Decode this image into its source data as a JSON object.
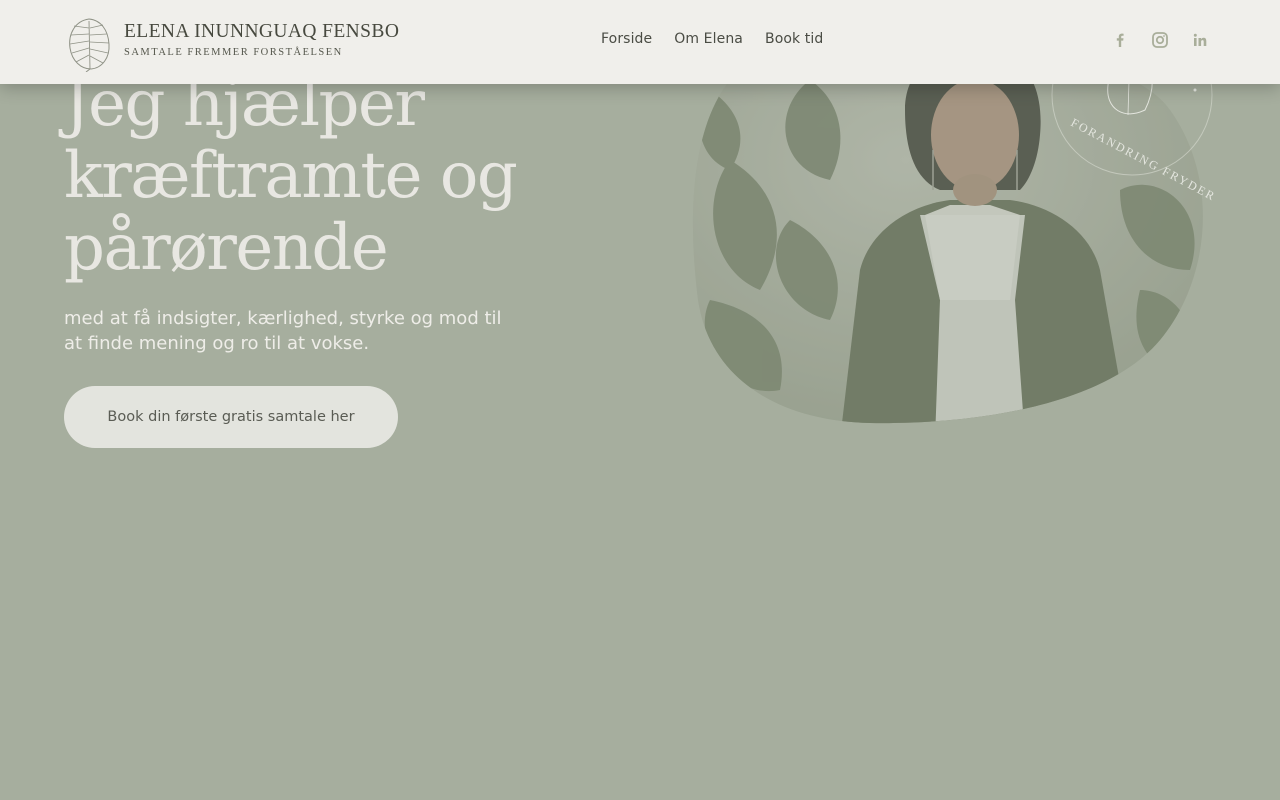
{
  "brand": {
    "name": "ELENA INUNNGUAQ FENSBO",
    "tagline": "SAMTALE FREMMER FORSTÅELSEN"
  },
  "nav": {
    "items": [
      {
        "label": "Forside"
      },
      {
        "label": "Om Elena"
      },
      {
        "label": "Book tid"
      }
    ]
  },
  "social": {
    "icons": [
      "facebook-icon",
      "instagram-icon",
      "linkedin-icon"
    ]
  },
  "hero": {
    "title_lines": [
      "Jeg hjælper",
      "kræftramte og",
      "pårørende"
    ],
    "subtitle": "med at få indsigter, kærlighed, styrke og mod til at finde mening og ro til at vokse.",
    "cta_label": "Book din første gratis samtale her"
  },
  "portrait": {
    "badge_text": "FORANDRING FRYDER"
  },
  "colors": {
    "background": "#a6ae9e",
    "header": "#f0efeb",
    "heading": "#e8e7e2",
    "button": "#e3e4de",
    "icon": "#a9ae9a"
  }
}
